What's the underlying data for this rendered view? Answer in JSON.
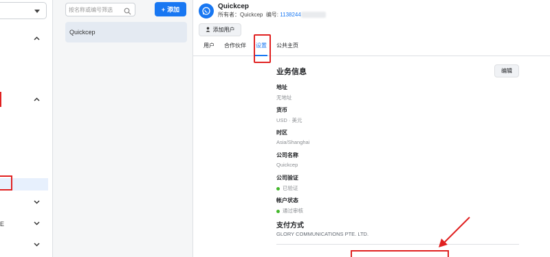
{
  "search": {
    "placeholder": "按名称或编号筛选"
  },
  "add_button": {
    "label": "添加"
  },
  "list": {
    "items": [
      {
        "name": "Quickcep"
      }
    ]
  },
  "nav": {
    "fragment": "E"
  },
  "account": {
    "name": "Quickcep",
    "owner_label": "所有者：",
    "owner": "Quickcep",
    "id_label": "编号:",
    "id_value": "1138244"
  },
  "add_user": {
    "label": "添加用户"
  },
  "tabs": [
    {
      "label": "用户"
    },
    {
      "label": "合作伙伴"
    },
    {
      "label": "设置"
    },
    {
      "label": "公共主页"
    }
  ],
  "business_info": {
    "title": "业务信息",
    "edit_label": "编辑",
    "fields": [
      {
        "label": "地址",
        "value": "无地址"
      },
      {
        "label": "货币",
        "value": "USD · 美元"
      },
      {
        "label": "时区",
        "value": "Asia/Shanghai"
      },
      {
        "label": "公司名称",
        "value": "Quickcep"
      },
      {
        "label": "公司验证",
        "value": "已验证"
      },
      {
        "label": "帐户状态",
        "value": "通过审核"
      }
    ]
  },
  "payment": {
    "title": "支付方式",
    "value": "GLORY COMMUNICATIONS PTE. LTD."
  },
  "colors": {
    "primary": "#1877f2",
    "highlight_red": "#e02020",
    "status_green": "#42b72a"
  }
}
